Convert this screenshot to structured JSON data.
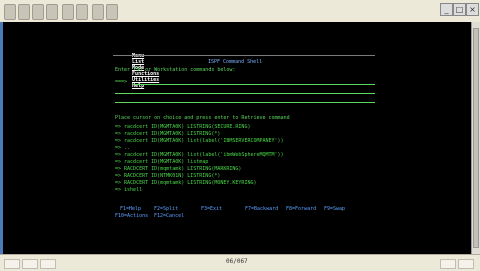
{
  "menu_bar": [
    "Menu",
    "List",
    "Mode",
    "Functions",
    "Utilities",
    "Help"
  ],
  "panel_title": "ISPF Command Shell",
  "instruction": "Enter TSO or Workstation commands below:",
  "prompt": "===>",
  "list_instruction": "Place cursor on choice and press enter to Retrieve command",
  "commands": [
    "=> racdcert ID(MGMTA0K) LISTRING(SECURE.RING)",
    "=> racdcert ID(MGMTA0K) LISTRING(*)",
    "=> racdcert ID(MGMTA0K) list(label('IBMSERVERCOMPANEY'))",
    "=> ..",
    "=> racdcert ID(MGMTA0K) list(label('ibmWebSphereMQMTM'))",
    "=> racdcert ID(MGMTA0K) listmap",
    "=> RACDCERT ID(mqmtamk) LISTRING(MARKRING)",
    "=> RACDCERT ID(NTMK01N) LISTRING(*)",
    "=> RACDCERT ID(mqmtamk) LISTRING(MONEY.KEYRING)",
    "=> ishell"
  ],
  "function_keys_row1": [
    "F1=Help",
    "F2=Split",
    "F3=Exit",
    "F7=Backward",
    "F8=Forward",
    "F9=Swap"
  ],
  "function_keys_row2": [
    "F10=Actions",
    "F12=Cancel"
  ],
  "status": {
    "cursor_position": "06/067"
  }
}
